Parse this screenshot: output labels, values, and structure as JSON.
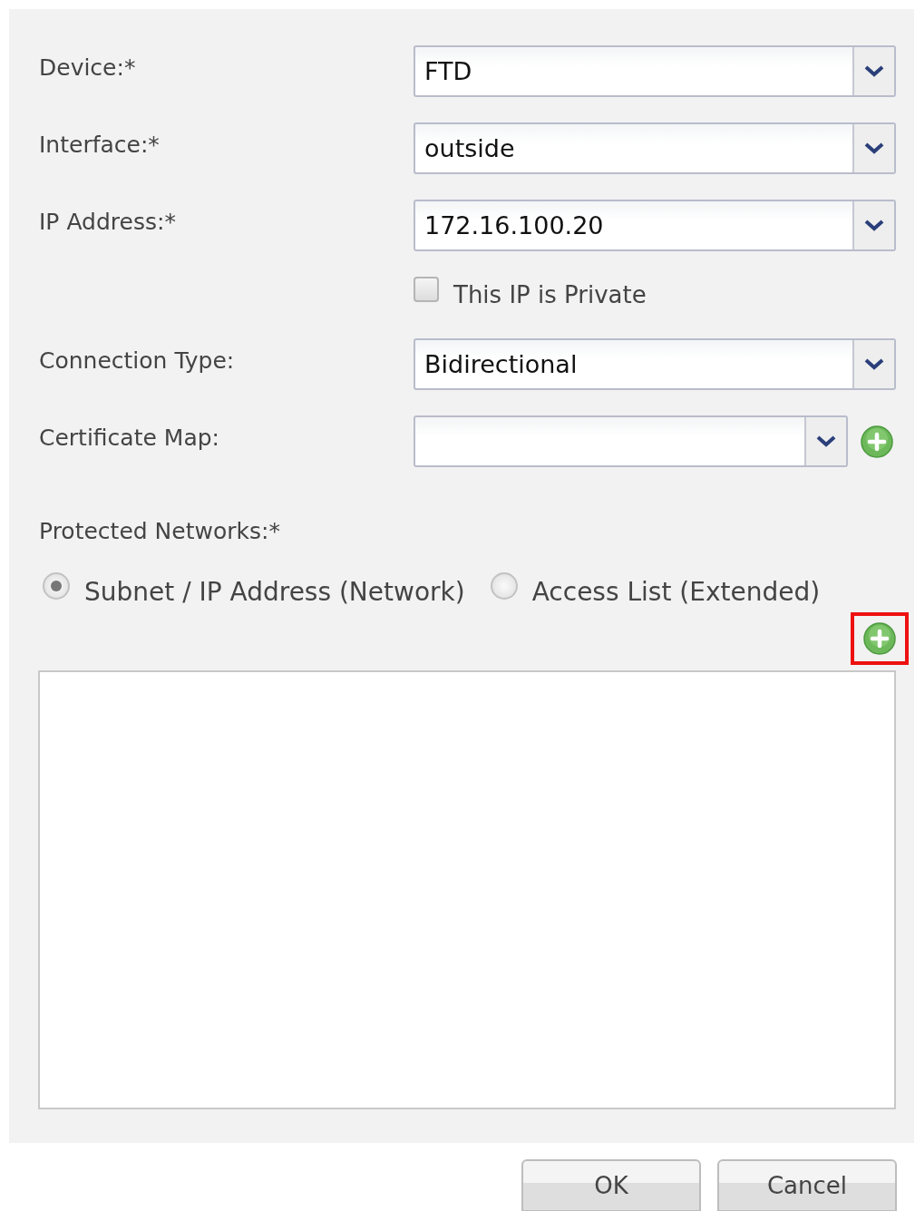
{
  "fields": [
    {
      "kind": "select",
      "label": "Device:*",
      "value": "FTD"
    },
    {
      "kind": "select",
      "label": "Interface:*",
      "value": "outside"
    },
    {
      "kind": "select",
      "label": "IP Address:*",
      "value": "172.16.100.20"
    },
    {
      "kind": "checkbox",
      "text": "This IP is Private",
      "checked": false
    },
    {
      "kind": "select",
      "label": "Connection Type:",
      "value": "Bidirectional"
    },
    {
      "kind": "select-add",
      "label": "Certificate Map:"
    }
  ],
  "protected_networks": {
    "label": "Protected Networks:*",
    "options": [
      {
        "label": "Subnet / IP Address (Network)",
        "selected": true
      },
      {
        "label": "Access List (Extended)",
        "selected": false
      }
    ],
    "add_button": {
      "highlighted": true
    }
  },
  "buttons": [
    "OK",
    "Cancel"
  ]
}
